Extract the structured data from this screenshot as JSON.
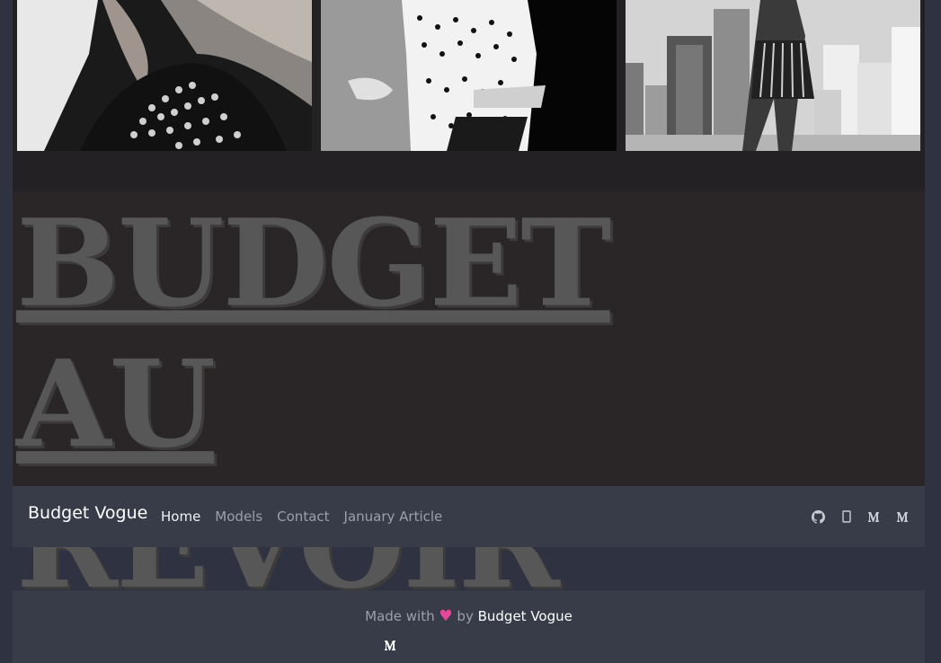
{
  "gallery": {
    "photos": [
      {
        "alt": "model-sequin-top"
      },
      {
        "alt": "model-polka-dot-dress"
      },
      {
        "alt": "model-city-skyline"
      }
    ]
  },
  "hero": {
    "title": "BUDGET AU REVOIR"
  },
  "navbar": {
    "brand": "Budget Vogue",
    "links": [
      "Home",
      "Models",
      "Contact",
      "January Article"
    ],
    "active": "Home",
    "social_icons": [
      "github-icon",
      "mobile-icon",
      "medium-icon",
      "medium-icon"
    ]
  },
  "footer": {
    "made_with": "Made with",
    "heart": "♥",
    "by": "by",
    "author": "Budget Vogue",
    "icon": "medium-icon"
  },
  "colors": {
    "background": "#2e3241",
    "bar": "#373c48",
    "heart": "#e8469a",
    "hero_text": "#585757"
  }
}
